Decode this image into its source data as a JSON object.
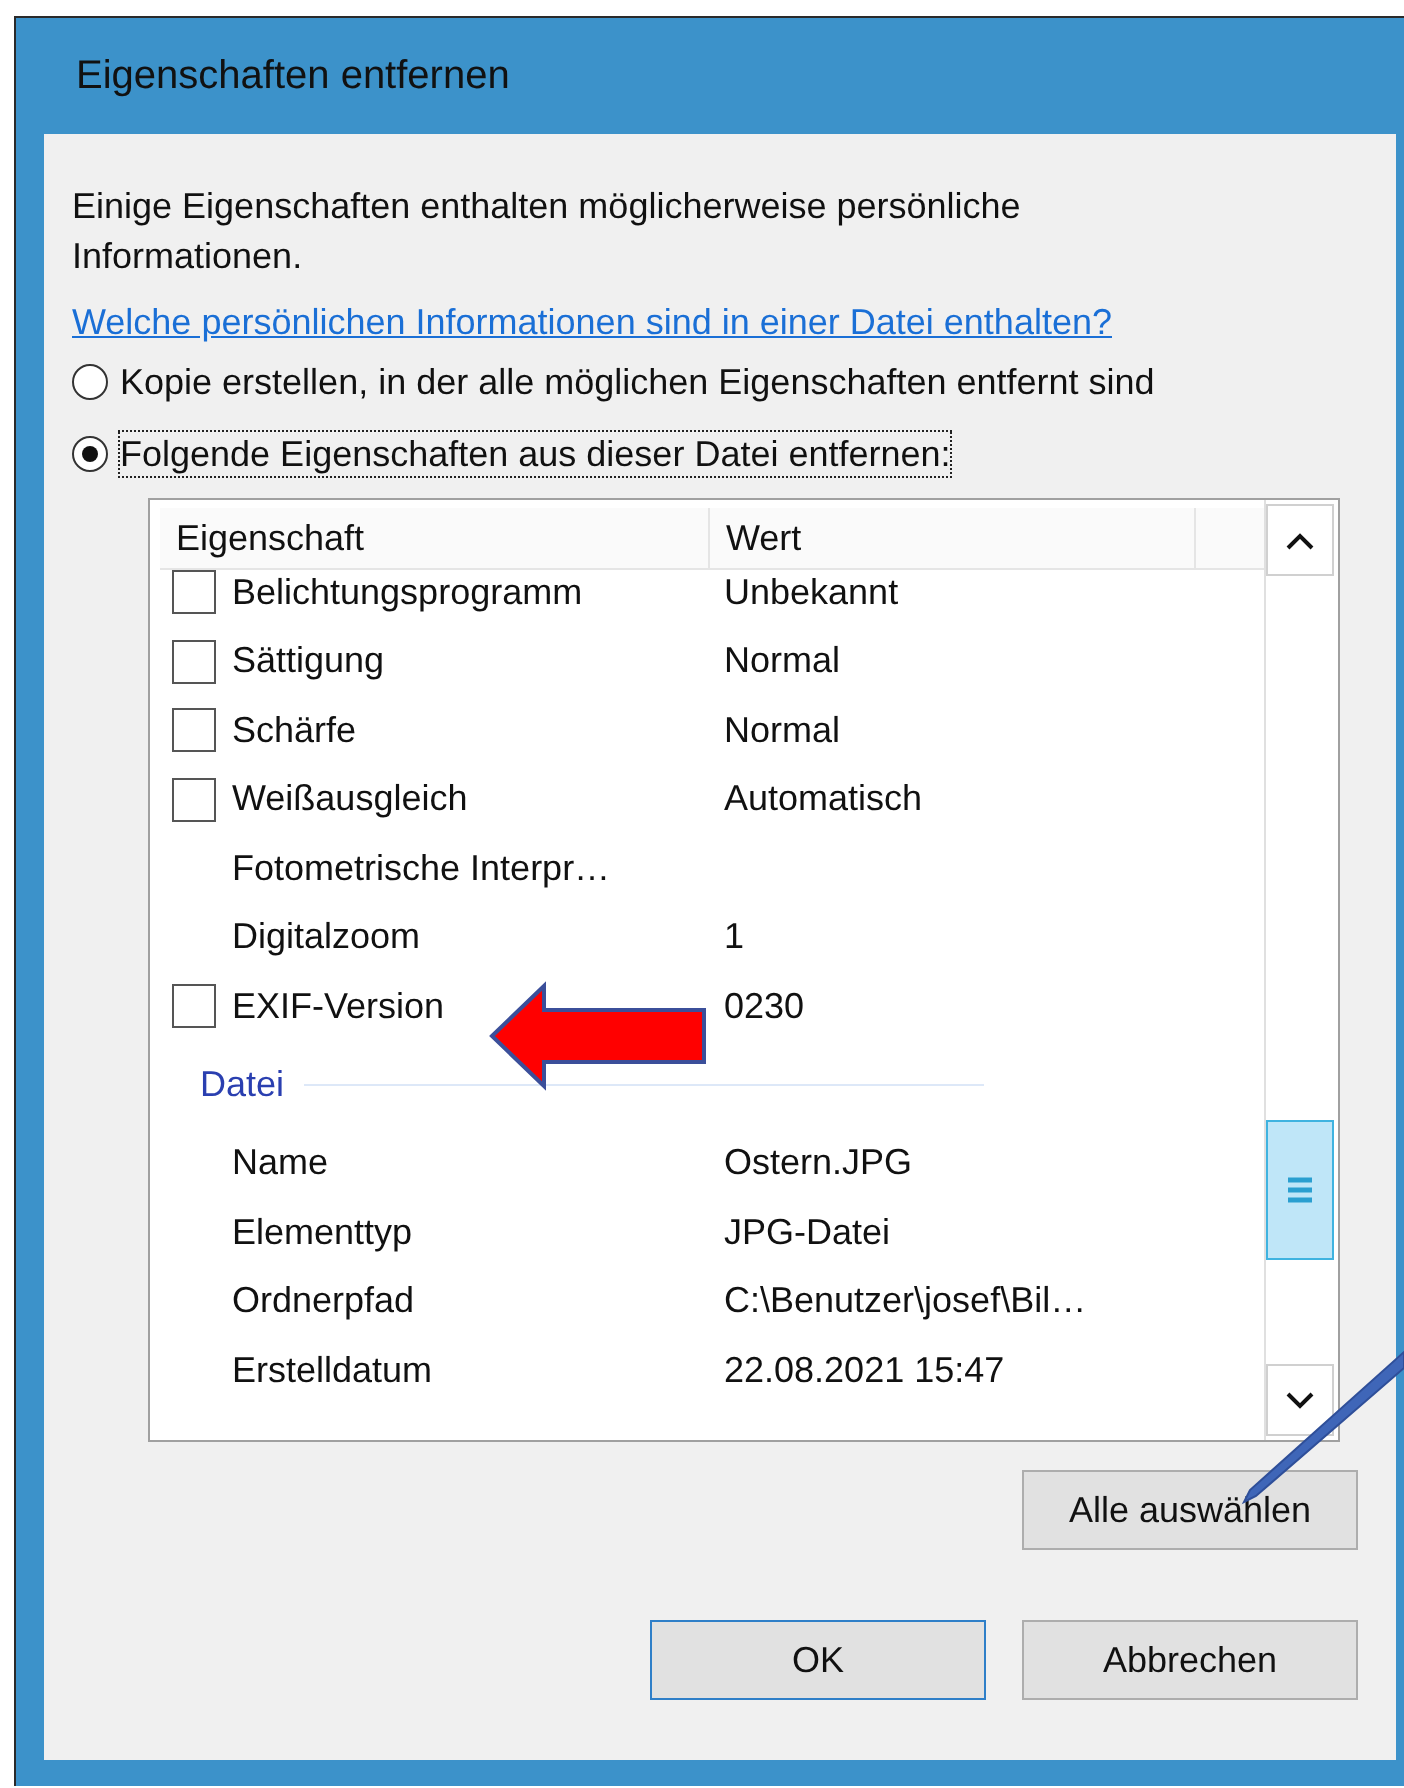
{
  "window": {
    "title": "Eigenschaften entfernen"
  },
  "intro": "Einige Eigenschaften enthalten möglicherweise persönliche Informationen.",
  "link": "Welche persönlichen Informationen sind in einer Datei enthalten?",
  "options": [
    {
      "label": "Kopie erstellen, in der alle möglichen Eigenschaften entfernt sind",
      "selected": false
    },
    {
      "label": "Folgende Eigenschaften aus dieser Datei entfernen:",
      "selected": true
    }
  ],
  "list": {
    "columns": [
      "Eigenschaft",
      "Wert"
    ],
    "rows": [
      {
        "kind": "checkbox",
        "name": "Belichtungsprogramm",
        "value": "Unbekannt",
        "checked": false
      },
      {
        "kind": "checkbox",
        "name": "Sättigung",
        "value": "Normal",
        "checked": false
      },
      {
        "kind": "checkbox",
        "name": "Schärfe",
        "value": "Normal",
        "checked": false
      },
      {
        "kind": "checkbox",
        "name": "Weißausgleich",
        "value": "Automatisch",
        "checked": false
      },
      {
        "kind": "plain",
        "name": "Fotometrische Interpr…"
      },
      {
        "kind": "plain",
        "name": "Digitalzoom",
        "value": "1"
      },
      {
        "kind": "checkbox",
        "name": "EXIF-Version",
        "value": "0230",
        "checked": false
      },
      {
        "kind": "group",
        "name": "Datei"
      },
      {
        "kind": "plain",
        "name": "Name",
        "value": "Ostern.JPG"
      },
      {
        "kind": "plain",
        "name": "Elementtyp",
        "value": "JPG-Datei"
      },
      {
        "kind": "plain",
        "name": "Ordnerpfad",
        "value": "C:\\Benutzer\\josef\\Bil…"
      },
      {
        "kind": "plain",
        "name": "Erstelldatum",
        "value": "22.08.2021 15:47"
      }
    ]
  },
  "buttons": {
    "select_all": "Alle auswählen",
    "ok": "OK",
    "cancel": "Abbrechen"
  }
}
